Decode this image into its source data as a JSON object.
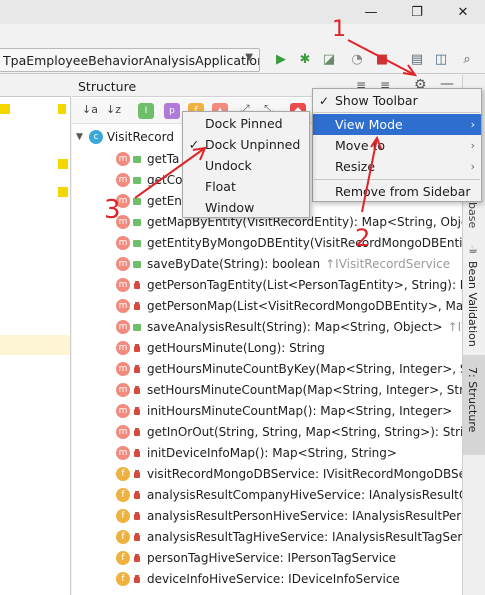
{
  "window": {
    "minimize": "—",
    "restore": "❐",
    "close": "✕"
  },
  "toolbar": {
    "run_config": "TpaEmployeeBehaviorAnalysisApplication",
    "dropdown": "▼"
  },
  "structure": {
    "title": "Structure",
    "root_node": "VisitRecord"
  },
  "tree": [
    {
      "text": "getTa",
      "kind": "m",
      "vis": "pub"
    },
    {
      "text": "getCo",
      "kind": "m",
      "vis": "pub"
    },
    {
      "text": "getEn",
      "kind": "m",
      "vis": "pub"
    },
    {
      "text": "getMapByEntity(VisitRecordEntity): Map<String, Object",
      "kind": "m",
      "vis": "pub"
    },
    {
      "text": "getEntityByMongoDBEntity(VisitRecordMongoDBEntity",
      "kind": "m",
      "vis": "pub"
    },
    {
      "text": "saveByDate(String): boolean",
      "inh": "↑IVisitRecordService",
      "kind": "m",
      "vis": "pub"
    },
    {
      "text": "getPersonTagEntity(List<PersonTagEntity>, String): Per",
      "kind": "m",
      "vis": "priv"
    },
    {
      "text": "getPersonMap(List<VisitRecordMongoDBEntity>, Map",
      "kind": "m",
      "vis": "priv"
    },
    {
      "text": "saveAnalysisResult(String): Map<String, Object>",
      "inh": "↑IVisi",
      "kind": "m",
      "vis": "pub"
    },
    {
      "text": "getHoursMinute(Long): String",
      "kind": "m",
      "vis": "priv"
    },
    {
      "text": "getHoursMinuteCountByKey(Map<String, Integer>, Str",
      "kind": "m",
      "vis": "priv"
    },
    {
      "text": "setHoursMinuteCountMap(Map<String, Integer>, Str",
      "kind": "m",
      "vis": "priv"
    },
    {
      "text": "initHoursMinuteCountMap(): Map<String, Integer>",
      "kind": "m",
      "vis": "priv"
    },
    {
      "text": "getInOrOut(String, String, Map<String, String>): String",
      "kind": "m",
      "vis": "priv"
    },
    {
      "text": "initDeviceInfoMap(): Map<String, String>",
      "kind": "m",
      "vis": "priv"
    },
    {
      "text": "visitRecordMongoDBService: IVisitRecordMongoDBSe",
      "kind": "f",
      "vis": "priv"
    },
    {
      "text": "analysisResultCompanyHiveService: IAnalysisResultCon",
      "kind": "f",
      "vis": "priv"
    },
    {
      "text": "analysisResultPersonHiveService: IAnalysisResultPerson",
      "kind": "f",
      "vis": "priv"
    },
    {
      "text": "analysisResultTagHiveService: IAnalysisResultTagServic",
      "kind": "f",
      "vis": "priv"
    },
    {
      "text": "personTagHiveService: IPersonTagService",
      "kind": "f",
      "vis": "priv"
    },
    {
      "text": "deviceInfoHiveService: IDeviceInfoService",
      "kind": "f",
      "vis": "priv"
    }
  ],
  "context_menu": {
    "items": [
      {
        "label": "Show Toolbar",
        "checked": true
      },
      {
        "label": "View Mode",
        "submenu": true,
        "highlighted": true
      },
      {
        "label": "Move to",
        "submenu": true
      },
      {
        "label": "Resize",
        "submenu": true
      },
      {
        "label": "Remove from Sidebar"
      }
    ]
  },
  "view_mode_menu": {
    "items": [
      {
        "label": "Dock Pinned"
      },
      {
        "label": "Dock Unpinned",
        "checked": true
      },
      {
        "label": "Undock"
      },
      {
        "label": "Float"
      },
      {
        "label": "Window"
      }
    ]
  },
  "right_sidebar": {
    "tab_base": "base",
    "tab_bean": "Bean Validation",
    "tab_structure": "7: Structure"
  },
  "annotations": {
    "n1": "1",
    "n2": "2",
    "n3": "3",
    "color": "#e0252a"
  },
  "icon_letters": {
    "method": "m",
    "field": "f",
    "class": "c",
    "check": "✓",
    "submenu_arrow": "›"
  }
}
